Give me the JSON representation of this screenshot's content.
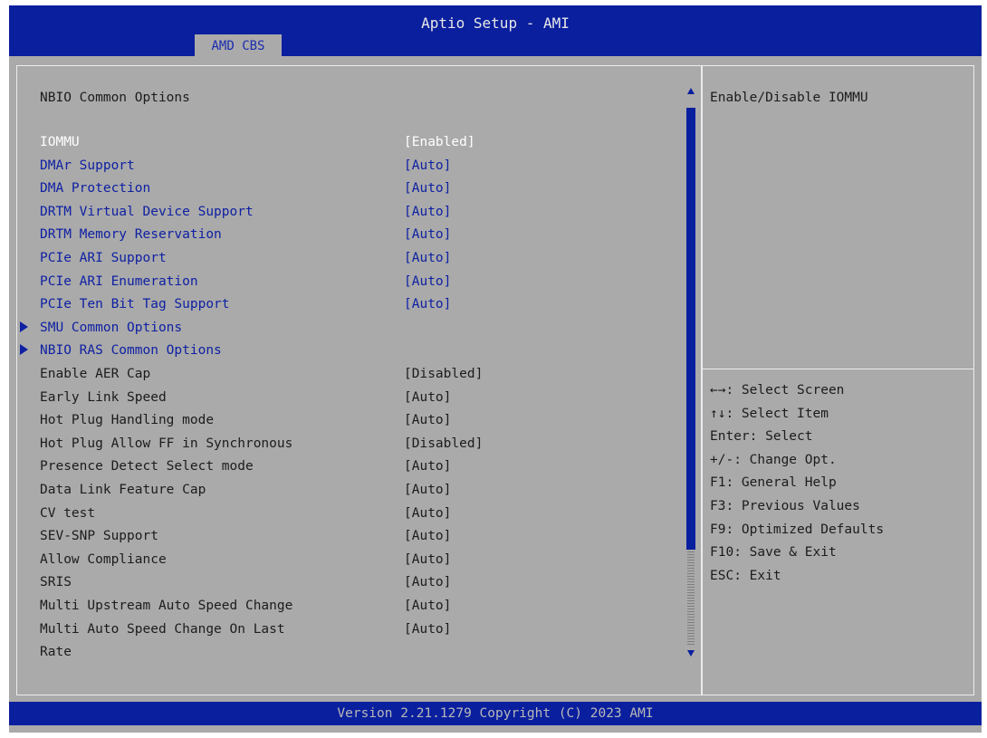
{
  "app": {
    "title": "Aptio Setup - AMI"
  },
  "tabs": [
    {
      "label": "AMD CBS"
    }
  ],
  "main": {
    "section_title": "NBIO Common Options",
    "items": [
      {
        "label": "IOMMU",
        "value": "[Enabled]",
        "kind": "setting",
        "selected": true
      },
      {
        "label": "DMAr Support",
        "value": "[Auto]",
        "kind": "setting"
      },
      {
        "label": "DMA Protection",
        "value": "[Auto]",
        "kind": "setting"
      },
      {
        "label": "DRTM Virtual Device Support",
        "value": "[Auto]",
        "kind": "setting"
      },
      {
        "label": "DRTM Memory Reservation",
        "value": "[Auto]",
        "kind": "setting"
      },
      {
        "label": "PCIe ARI Support",
        "value": "[Auto]",
        "kind": "setting"
      },
      {
        "label": "PCIe ARI Enumeration",
        "value": "[Auto]",
        "kind": "setting"
      },
      {
        "label": "PCIe Ten Bit Tag Support",
        "value": "[Auto]",
        "kind": "setting"
      },
      {
        "label": "SMU Common Options",
        "value": "",
        "kind": "submenu"
      },
      {
        "label": "NBIO RAS Common Options",
        "value": "",
        "kind": "submenu"
      },
      {
        "label": "Enable AER Cap",
        "value": "[Disabled]",
        "kind": "text"
      },
      {
        "label": "Early Link Speed",
        "value": "[Auto]",
        "kind": "text"
      },
      {
        "label": "Hot Plug Handling mode",
        "value": "[Auto]",
        "kind": "text"
      },
      {
        "label": "Hot Plug Allow FF in Synchronous",
        "value": "[Disabled]",
        "kind": "text"
      },
      {
        "label": "Presence Detect Select mode",
        "value": "[Auto]",
        "kind": "text"
      },
      {
        "label": "Data Link Feature Cap",
        "value": "[Auto]",
        "kind": "text"
      },
      {
        "label": "CV test",
        "value": "[Auto]",
        "kind": "text"
      },
      {
        "label": "SEV-SNP Support",
        "value": "[Auto]",
        "kind": "text"
      },
      {
        "label": "Allow Compliance",
        "value": "[Auto]",
        "kind": "text"
      },
      {
        "label": "SRIS",
        "value": "[Auto]",
        "kind": "text"
      },
      {
        "label": "Multi Upstream Auto Speed Change",
        "value": "[Auto]",
        "kind": "text"
      },
      {
        "label": "Multi Auto Speed Change On Last",
        "value": "[Auto]",
        "kind": "text"
      },
      {
        "label": "Rate",
        "value": "",
        "kind": "text"
      }
    ]
  },
  "help": {
    "description": "Enable/Disable IOMMU",
    "keys": [
      "←→: Select Screen",
      "↑↓: Select Item",
      "Enter: Select",
      "+/-: Change Opt.",
      "F1: General Help",
      "F3: Previous Values",
      "F9: Optimized Defaults",
      "F10: Save & Exit",
      "ESC: Exit"
    ]
  },
  "footer": {
    "text": "Version 2.21.1279 Copyright (C) 2023 AMI"
  },
  "colors": {
    "header_bg": "#0a1f9e",
    "panel_bg": "#aaaaaa",
    "option_text": "#0f21a2",
    "selected_text": "#ffffff",
    "static_text": "#1c1c1c"
  }
}
